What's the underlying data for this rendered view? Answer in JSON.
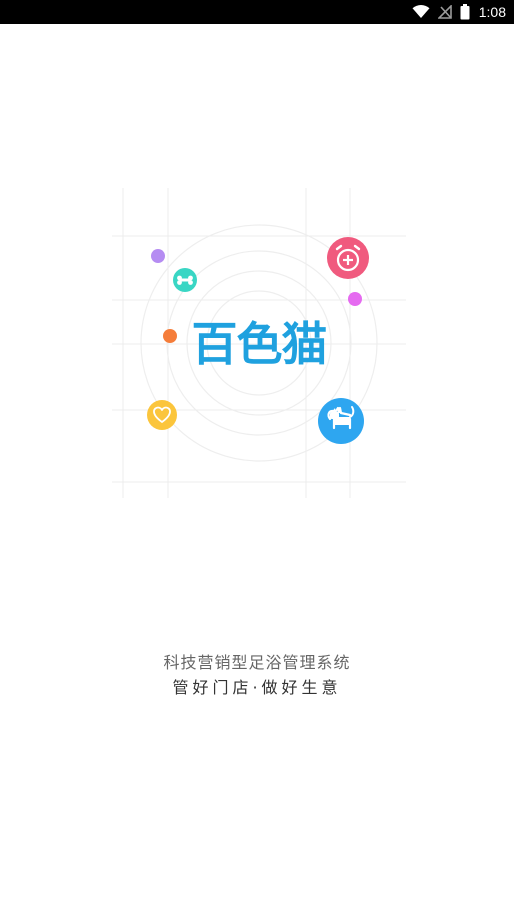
{
  "status_bar": {
    "time": "1:08",
    "icons": [
      "wifi-icon",
      "no-signal-icon",
      "battery-icon"
    ]
  },
  "logo": {
    "text": "百色猫",
    "color": "#1fa1df"
  },
  "illustration": {
    "icons": [
      "bone-icon",
      "alarm-icon",
      "heart-icon",
      "cat-icon"
    ],
    "colors": {
      "bone": "#39d6c4",
      "alarm": "#f05a7e",
      "heart": "#fbc53c",
      "cat": "#2ea6f0",
      "dot_purple": "#b58cf2",
      "dot_orange": "#f57d3a",
      "dot_magenta": "#e56af0"
    }
  },
  "tagline": "科技营销型足浴管理系统",
  "slogan": "管好门店·做好生意"
}
